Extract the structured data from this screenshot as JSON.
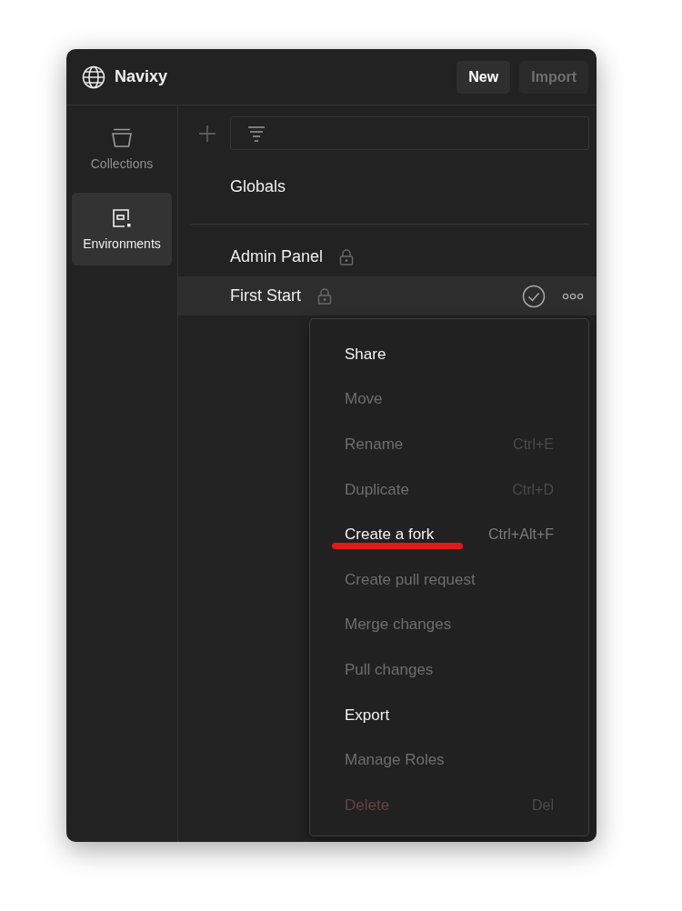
{
  "header": {
    "title": "Navixy",
    "buttons": [
      {
        "label": "New",
        "disabled": false
      },
      {
        "label": "Import",
        "disabled": true
      }
    ]
  },
  "sidebar": {
    "items": [
      {
        "label": "Collections",
        "kind": "collections",
        "selected": false
      },
      {
        "label": "Environments",
        "kind": "environments",
        "selected": true
      }
    ]
  },
  "globals": {
    "label": "Globals"
  },
  "environments": [
    {
      "name": "Admin Panel",
      "locked": true,
      "selected": false,
      "active": false
    },
    {
      "name": "First Start",
      "locked": true,
      "selected": true,
      "active": true
    }
  ],
  "context_menu": {
    "items": [
      {
        "label": "Share",
        "disabled": false,
        "kind": "normal"
      },
      {
        "label": "Move",
        "disabled": true,
        "kind": "normal"
      },
      {
        "label": "Rename",
        "shortcut": "Ctrl+E",
        "disabled": true,
        "kind": "normal"
      },
      {
        "label": "Duplicate",
        "shortcut": "Ctrl+D",
        "disabled": true,
        "kind": "normal"
      },
      {
        "label": "Create a fork",
        "shortcut": "Ctrl+Alt+F",
        "disabled": false,
        "kind": "normal",
        "underlined": true
      },
      {
        "label": "Create pull request",
        "disabled": true,
        "kind": "normal"
      },
      {
        "label": "Merge changes",
        "disabled": true,
        "kind": "normal"
      },
      {
        "label": "Pull changes",
        "disabled": true,
        "kind": "normal"
      },
      {
        "label": "Export",
        "disabled": false,
        "kind": "normal"
      },
      {
        "label": "Manage Roles",
        "disabled": true,
        "kind": "normal"
      },
      {
        "label": "Delete",
        "shortcut": "Del",
        "disabled": true,
        "kind": "danger"
      }
    ]
  }
}
